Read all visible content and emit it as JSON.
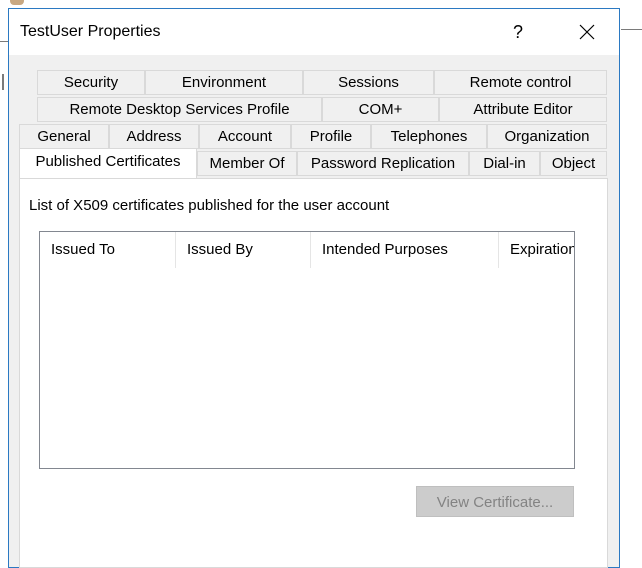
{
  "window": {
    "title": "TestUser Properties",
    "help_glyph": "?"
  },
  "tabs": {
    "row1": [
      "Security",
      "Environment",
      "Sessions",
      "Remote control"
    ],
    "row2": [
      "Remote Desktop Services Profile",
      "COM+",
      "Attribute Editor"
    ],
    "row3": [
      "General",
      "Address",
      "Account",
      "Profile",
      "Telephones",
      "Organization"
    ],
    "row4": [
      "Published Certificates",
      "Member Of",
      "Password Replication",
      "Dial-in",
      "Object"
    ],
    "active": "Published Certificates"
  },
  "panel": {
    "description": "List of X509 certificates published for the user account",
    "columns": [
      "Issued To",
      "Issued By",
      "Intended Purposes",
      "Expiration"
    ],
    "view_certificate_label": "View Certificate..."
  },
  "icons": {
    "close": "close-icon",
    "help": "help-icon"
  },
  "colors": {
    "window_border": "#2b79c2",
    "dialog_bg": "#f0f0f0",
    "disabled_text": "#838383"
  }
}
